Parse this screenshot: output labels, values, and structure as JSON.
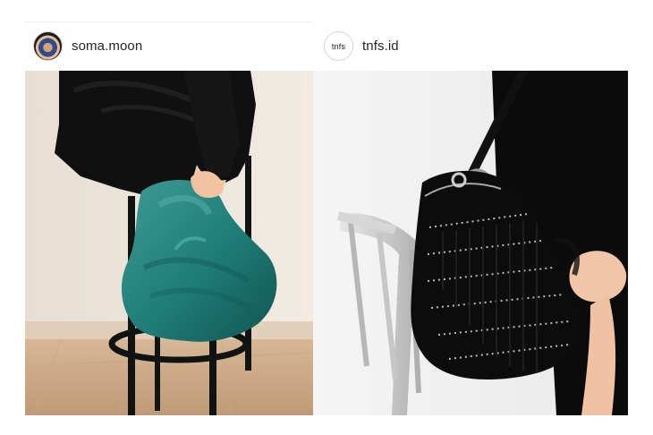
{
  "posts": [
    {
      "username": "soma.moon",
      "avatar_icon": "profile-photo-avatar",
      "image_alt": "teal-satin-bag-photo",
      "colors": {
        "bag": "#1f7b77",
        "jacket": "#111111",
        "wall": "#efe7dc",
        "floor": "#cfae8d"
      }
    },
    {
      "username": "tnfs.id",
      "avatar_text": "tnfs",
      "image_alt": "black-fringe-bag-photo",
      "colors": {
        "bag": "#0c0c0c",
        "wall": "#f3f3f3",
        "chair": "#bdbdbd"
      }
    }
  ]
}
